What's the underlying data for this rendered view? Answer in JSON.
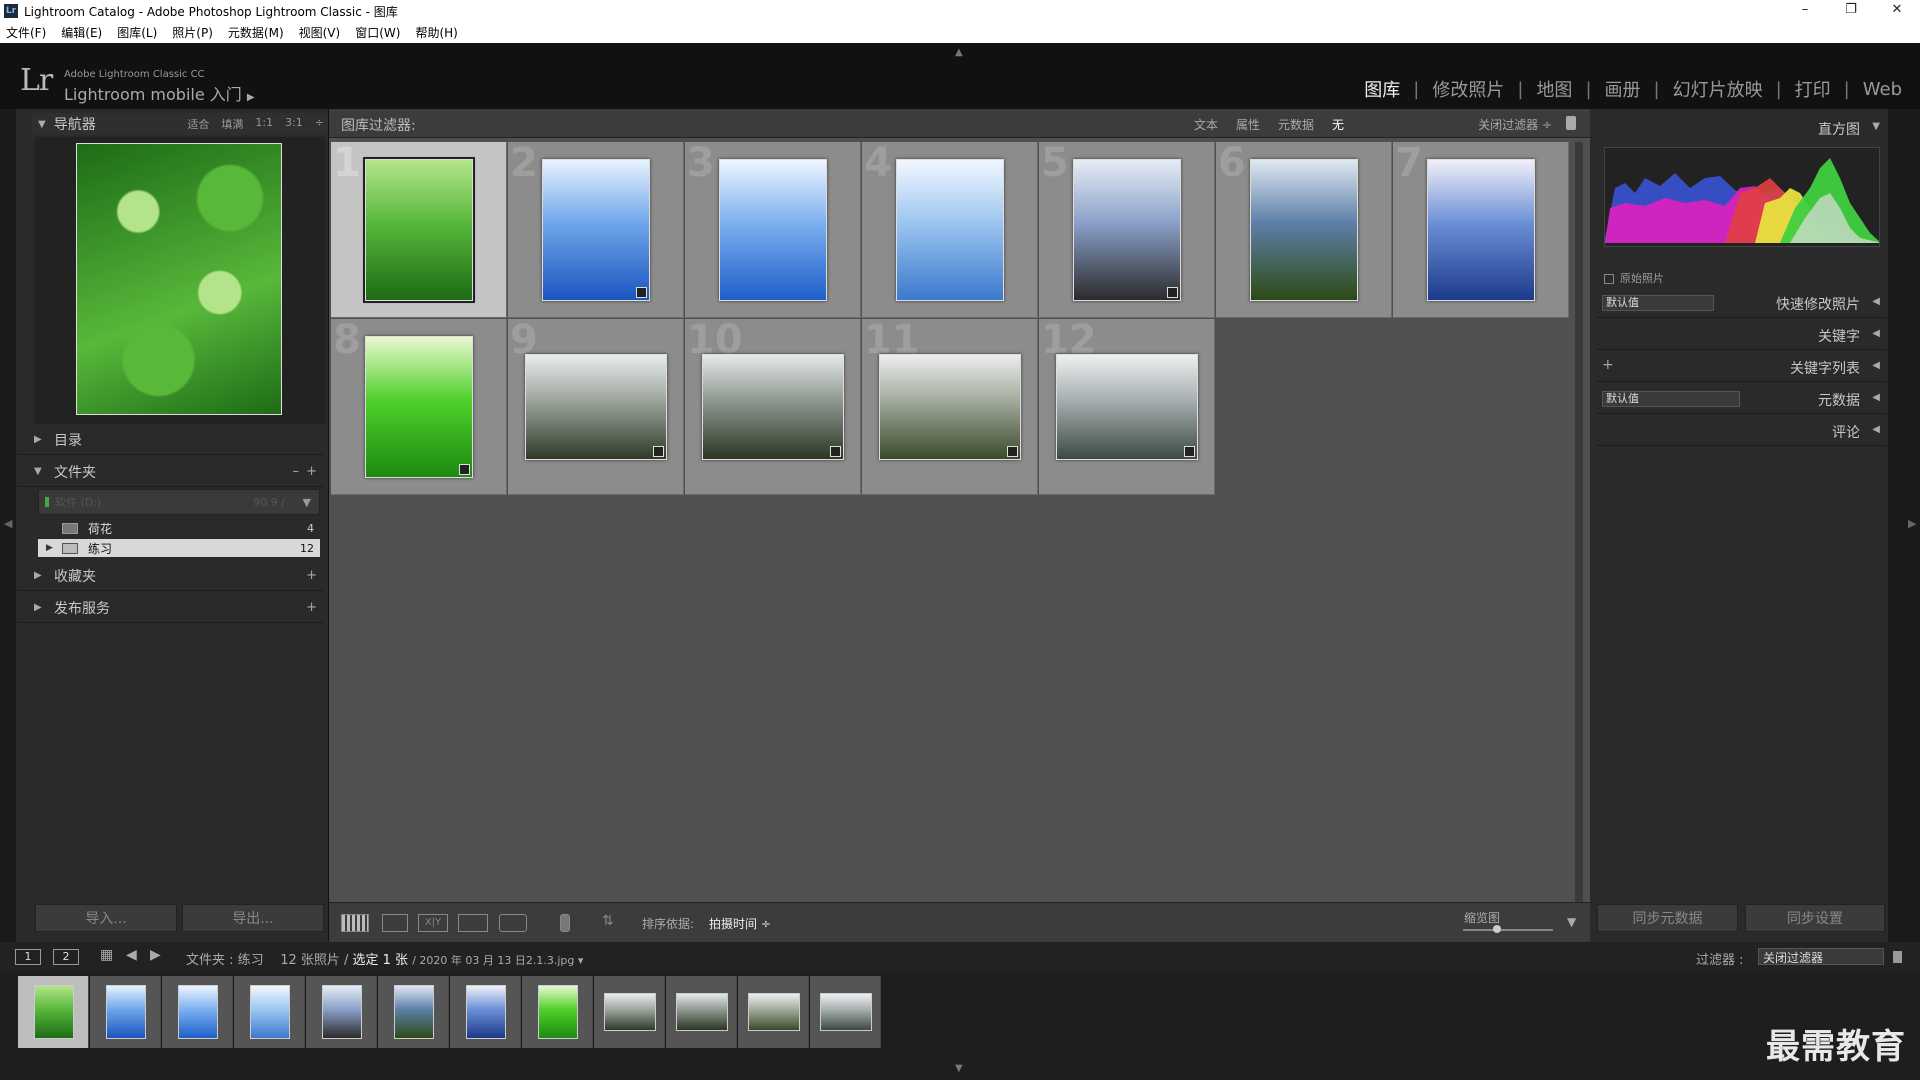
{
  "window": {
    "title": "Lightroom Catalog - Adobe Photoshop Lightroom Classic - 图库",
    "app_icon": "Lr",
    "minimize": "–",
    "restore": "❐",
    "close": "✕"
  },
  "menu": [
    "文件(F)",
    "编辑(E)",
    "图库(L)",
    "照片(P)",
    "元数据(M)",
    "视图(V)",
    "窗口(W)",
    "帮助(H)"
  ],
  "identity": {
    "logo": "Lr",
    "product": "Adobe Lightroom Classic CC",
    "mobile": "Lightroom mobile 入门",
    "arrow": "▶"
  },
  "modules": [
    {
      "label": "图库",
      "active": true
    },
    {
      "label": "修改照片",
      "active": false
    },
    {
      "label": "地图",
      "active": false
    },
    {
      "label": "画册",
      "active": false
    },
    {
      "label": "幻灯片放映",
      "active": false
    },
    {
      "label": "打印",
      "active": false
    },
    {
      "label": "Web",
      "active": false
    }
  ],
  "navigator": {
    "title": "导航器",
    "options": [
      "适合",
      "填满",
      "1:1",
      "3:1"
    ]
  },
  "left_panels": {
    "catalog": "目录",
    "folders": "文件夹",
    "folders_minus": "–",
    "folders_plus": "+",
    "volume": "软件 (D:)",
    "volume_size": "90.9 /",
    "folder_items": [
      {
        "name": "荷花",
        "count": "4"
      },
      {
        "name": "练习",
        "count": "12"
      }
    ],
    "collections": "收藏夹",
    "collections_plus": "+",
    "publish": "发布服务",
    "publish_plus": "+",
    "import_btn": "导入...",
    "export_btn": "导出..."
  },
  "filter_bar": {
    "title": "图库过滤器:",
    "tabs": [
      {
        "label": "文本",
        "on": false
      },
      {
        "label": "属性",
        "on": false
      },
      {
        "label": "元数据",
        "on": false
      },
      {
        "label": "无",
        "on": true
      }
    ],
    "off_label": "关闭过滤器 ÷"
  },
  "grid": {
    "cells": [
      {
        "num": "1",
        "selected": true,
        "orient": "p",
        "colors": [
          "#1e6b16",
          "#57b83a",
          "#b4e48a"
        ],
        "badge": false
      },
      {
        "num": "2",
        "selected": false,
        "orient": "p",
        "colors": [
          "#1a55c0",
          "#6fa6ea",
          "#e8f2ff"
        ],
        "badge": true
      },
      {
        "num": "3",
        "selected": false,
        "orient": "p",
        "colors": [
          "#1e5fc8",
          "#7cb0f0",
          "#eef5ff"
        ],
        "badge": false
      },
      {
        "num": "4",
        "selected": false,
        "orient": "p",
        "colors": [
          "#3a79cc",
          "#9cc6f0",
          "#f2f7ff"
        ],
        "badge": false
      },
      {
        "num": "5",
        "selected": false,
        "orient": "p",
        "colors": [
          "#2b2b2b",
          "#8aa0c8",
          "#e6ecf5"
        ],
        "badge": true
      },
      {
        "num": "6",
        "selected": false,
        "orient": "p",
        "colors": [
          "#2d4a14",
          "#5d7fa8",
          "#dfe8f2"
        ],
        "badge": false
      },
      {
        "num": "7",
        "selected": false,
        "orient": "p",
        "colors": [
          "#1c3a8a",
          "#6b8fd6",
          "#f0f0f8"
        ],
        "badge": false
      },
      {
        "num": "8",
        "selected": false,
        "orient": "p",
        "colors": [
          "#1d8a10",
          "#4fd02a",
          "#eaf8d0"
        ],
        "badge": true
      },
      {
        "num": "9",
        "selected": false,
        "orient": "l",
        "colors": [
          "#2e3a26",
          "#9aa39a",
          "#e8ecec"
        ],
        "badge": true
      },
      {
        "num": "10",
        "selected": false,
        "orient": "l",
        "colors": [
          "#2c3624",
          "#8c968e",
          "#e5e9e8"
        ],
        "badge": true
      },
      {
        "num": "11",
        "selected": false,
        "orient": "l",
        "colors": [
          "#3a4a28",
          "#a0a89a",
          "#eceeec"
        ],
        "badge": true
      },
      {
        "num": "12",
        "selected": false,
        "orient": "l",
        "colors": [
          "#3c4a42",
          "#a4acae",
          "#eef0f0"
        ],
        "badge": true
      }
    ]
  },
  "toolbar": {
    "sort_label": "排序依据:",
    "sort_value": "拍摄时间 ÷",
    "zoom_label": "缩览图",
    "xy_label": "X|Y"
  },
  "right_panels": {
    "histogram": "直方图",
    "original_photo": "原始照片",
    "quick_develop": "快速修改照片",
    "quick_preset": "默认值",
    "keywording": "关键字",
    "keyword_plus": "+",
    "keyword_list": "关键字列表",
    "metadata": "元数据",
    "metadata_preset": "默认值",
    "comments": "评论",
    "sync_metadata": "同步元数据",
    "sync_settings": "同步设置"
  },
  "secondary_bar": {
    "page1": "1",
    "page2": "2",
    "source": "文件夹 : 练习",
    "count": "12 张照片 /",
    "selected": "选定 1 张",
    "file": "/ 2020 年 03 月 13 日2.1.3.jpg ▾",
    "filter_label": "过滤器 :",
    "filter_value": "关闭过滤器"
  },
  "watermark": "最需教育",
  "colors": {
    "panel": "#2a2a2a",
    "grid_bg": "#505050",
    "cell": "#8c8c8c",
    "cell_selected": "#c4c4c4"
  }
}
